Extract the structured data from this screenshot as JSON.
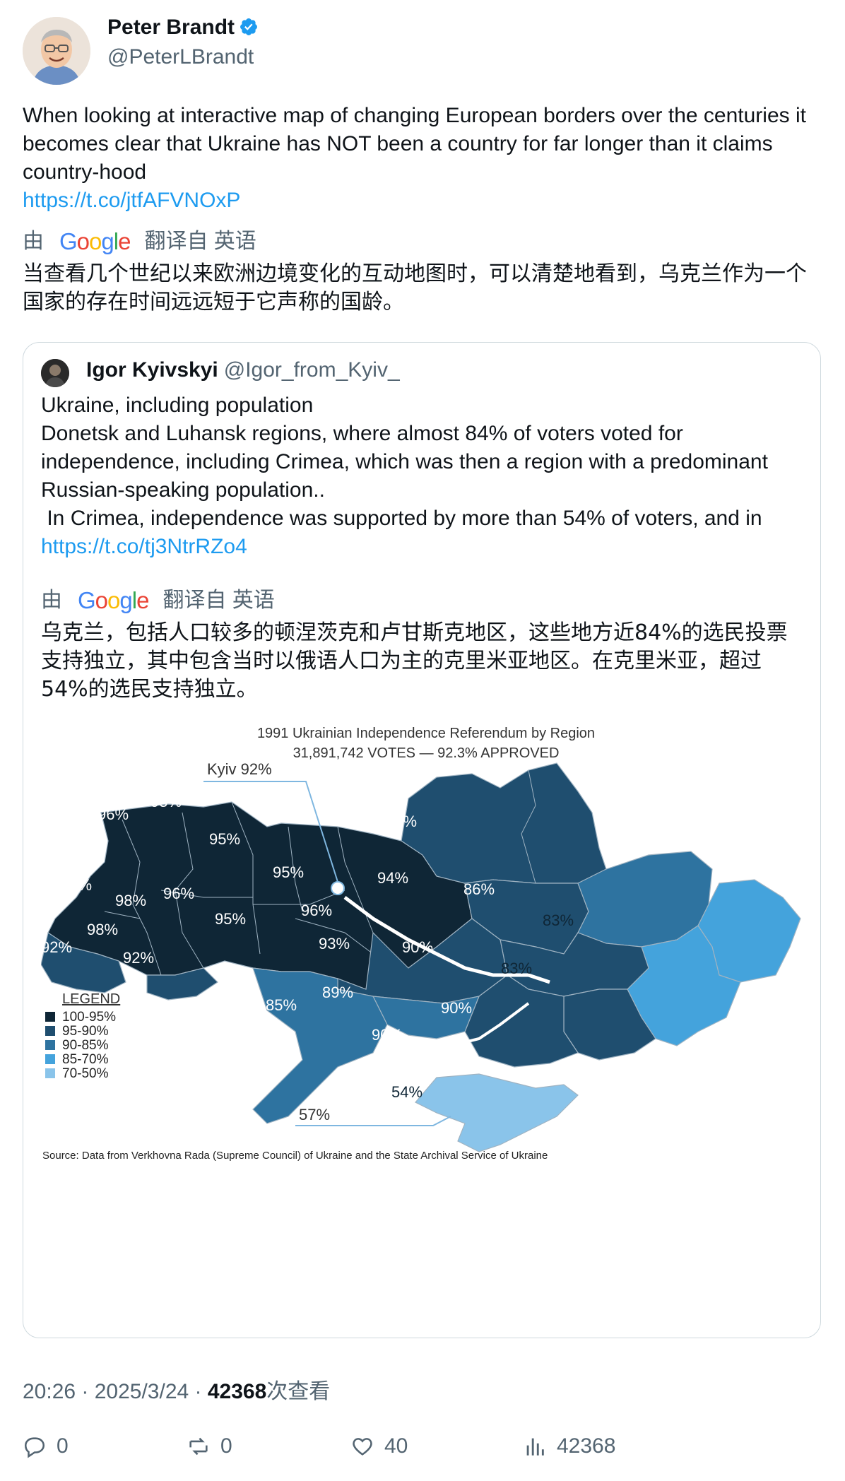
{
  "author": {
    "name": "Peter Brandt",
    "handle": "@PeterLBrandt",
    "verified_icon": "verified-badge-icon"
  },
  "tweet": {
    "text": "When looking at interactive map of changing European borders over the centuries it becomes clear that Ukraine has NOT been a country for far longer than it claims country-hood",
    "link": "https://t.co/jtfAFVNOxP",
    "translation_prefix": "由",
    "translation_brand": "Google",
    "translation_suffix": "翻译自 英语",
    "translation": "当查看几个世纪以来欧洲边境变化的互动地图时，可以清楚地看到，乌克兰作为一个国家的存在时间远远短于它声称的国龄。"
  },
  "quote": {
    "name": "Igor Kyivskyi",
    "handle": "@Igor_from_Kyiv_",
    "line1": "Ukraine, including population",
    "line2": "Donetsk and Luhansk regions, where almost 84% of voters voted for independence, including Crimea, which was then a region with a predominant Russian-speaking population..",
    "line3": " In Crimea, independence was supported by more than 54% of voters, and in",
    "link": "https://t.co/tj3NtrRZo4",
    "translation_prefix": "由",
    "translation_brand": "Google",
    "translation_suffix": "翻译自 英语",
    "translation": "乌克兰，包括人口较多的顿涅茨克和卢甘斯克地区，这些地方近84%的选民投票支持独立，其中包含当时以俄语人口为主的克里米亚地区。在克里米亚，超过54%的选民支持独立。"
  },
  "map": {
    "title": "1991 Ukrainian Independence Referendum by Region",
    "subtitle": "31,891,742 VOTES — 92.3% APPROVED",
    "kyiv_label": "Kyiv 92%",
    "sevastopol_label": "57%",
    "source": "Source: Data from Verkhovna Rada (Supreme Council) of Ukraine and the State Archival Service of Ukraine",
    "legend_title": "LEGEND",
    "legend": [
      {
        "label": "100-95%",
        "color": "#0f2636"
      },
      {
        "label": "95-90%",
        "color": "#1f4e6f"
      },
      {
        "label": "90-85%",
        "color": "#2e73a0"
      },
      {
        "label": "85-70%",
        "color": "#44a3dc"
      },
      {
        "label": "70-50%",
        "color": "#8ac4ea"
      }
    ],
    "regions": [
      {
        "label": "96%",
        "color": "#0f2636"
      },
      {
        "label": "95%",
        "color": "#0f2636"
      },
      {
        "label": "95%",
        "color": "#0f2636"
      },
      {
        "label": "97%",
        "color": "#0f2636"
      },
      {
        "label": "98%",
        "color": "#0f2636"
      },
      {
        "label": "96%",
        "color": "#0f2636"
      },
      {
        "label": "95%",
        "color": "#0f2636"
      },
      {
        "label": "95%",
        "color": "#0f2636"
      },
      {
        "label": "96%",
        "color": "#0f2636"
      },
      {
        "label": "98%",
        "color": "#0f2636"
      },
      {
        "label": "92%",
        "color": "#1f4e6f"
      },
      {
        "label": "92%",
        "color": "#1f4e6f"
      },
      {
        "label": "93%",
        "color": "#1f4e6f"
      },
      {
        "label": "92%",
        "color": "#1f4e6f"
      },
      {
        "label": "94%",
        "color": "#1f4e6f"
      },
      {
        "label": "86%",
        "color": "#2e73a0"
      },
      {
        "label": "83%",
        "color": "#44a3dc"
      },
      {
        "label": "83%",
        "color": "#44a3dc"
      },
      {
        "label": "93%",
        "color": "#1f4e6f"
      },
      {
        "label": "90%",
        "color": "#1f4e6f"
      },
      {
        "label": "85%",
        "color": "#2e73a0"
      },
      {
        "label": "89%",
        "color": "#2e73a0"
      },
      {
        "label": "90%",
        "color": "#1f4e6f"
      },
      {
        "label": "90%",
        "color": "#1f4e6f"
      },
      {
        "label": "54%",
        "color": "#8ac4ea"
      }
    ]
  },
  "meta": {
    "time": "20:26 · 2025/3/24 · ",
    "views": "42368",
    "views_suffix": "次查看"
  },
  "actions": {
    "replies": "0",
    "retweets": "0",
    "likes": "40",
    "views": "42368"
  }
}
